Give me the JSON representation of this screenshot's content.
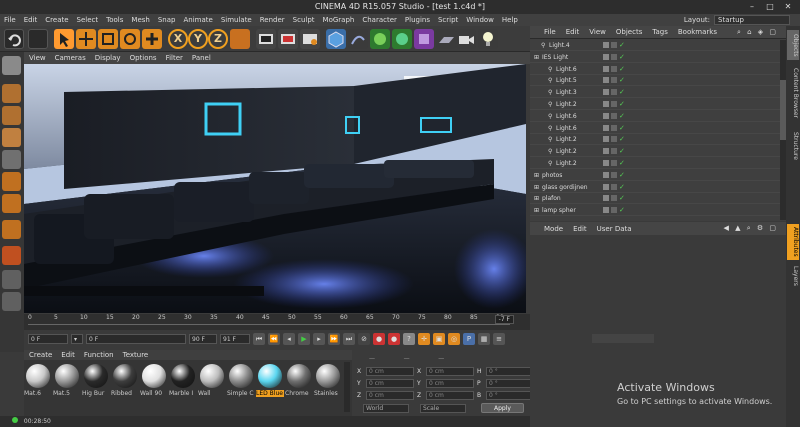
{
  "window": {
    "title": "CINEMA 4D R15.057 Studio - [test 1.c4d *]"
  },
  "menu": [
    "File",
    "Edit",
    "Create",
    "Select",
    "Tools",
    "Mesh",
    "Snap",
    "Animate",
    "Simulate",
    "Render",
    "Sculpt",
    "MoGraph",
    "Character",
    "Plugins",
    "Script",
    "Window",
    "Help"
  ],
  "layout": {
    "label": "Layout:",
    "value": "Startup"
  },
  "toolbar": {
    "axis_x": "X",
    "axis_y": "Y",
    "axis_z": "Z"
  },
  "viewport_menu": [
    "View",
    "Cameras",
    "Display",
    "Options",
    "Filter",
    "Panel"
  ],
  "timeline": {
    "ticks": [
      "0",
      "5",
      "10",
      "15",
      "20",
      "25",
      "30",
      "35",
      "40",
      "45",
      "50",
      "55",
      "60",
      "65",
      "70",
      "75",
      "80",
      "85",
      "90"
    ],
    "current_frame": "-7 F"
  },
  "transport": {
    "start": "0 F",
    "current": "0 F",
    "end": "90 F",
    "preview_end": "91 F"
  },
  "material_menu": [
    "Create",
    "Edit",
    "Function",
    "Texture"
  ],
  "materials": [
    {
      "name": "Mat.6",
      "color": "#c8c8c8"
    },
    {
      "name": "Mat.5",
      "color": "#9a9a9a"
    },
    {
      "name": "Hig Bur",
      "color": "#2a2a2a"
    },
    {
      "name": "Ribbed",
      "color": "#3d3d3d"
    },
    {
      "name": "Wall 90",
      "color": "#e0e0e0"
    },
    {
      "name": "Marble I",
      "color": "#222222"
    },
    {
      "name": "Wall",
      "color": "#bdbdbd"
    },
    {
      "name": "Simple C",
      "color": "#8c8c8c"
    },
    {
      "name": "LED Blue",
      "color": "#5ad6f0",
      "selected": true
    },
    {
      "name": "Chrome",
      "color": "#6f6f6f"
    },
    {
      "name": "Stainles",
      "color": "#9b9b9b"
    }
  ],
  "coords": {
    "rows": [
      {
        "a": "X",
        "v1": "0 cm",
        "b": "X",
        "v2": "0 cm",
        "c": "H",
        "v3": "0 °"
      },
      {
        "a": "Y",
        "v1": "0 cm",
        "b": "Y",
        "v2": "0 cm",
        "c": "P",
        "v3": "0 °"
      },
      {
        "a": "Z",
        "v1": "0 cm",
        "b": "Z",
        "v2": "0 cm",
        "c": "B",
        "v3": "0 °"
      }
    ],
    "mode": "World",
    "scale": "Scale",
    "apply": "Apply"
  },
  "status": {
    "time": "00:28:50"
  },
  "object_manager": {
    "menu": [
      "File",
      "Edit",
      "View",
      "Objects",
      "Tags",
      "Bookmarks"
    ],
    "rows": [
      {
        "name": "Light.4",
        "indent": 1
      },
      {
        "name": "IES Light",
        "indent": 0
      },
      {
        "name": "Light.6",
        "indent": 2
      },
      {
        "name": "Light.5",
        "indent": 2
      },
      {
        "name": "Light.3",
        "indent": 2
      },
      {
        "name": "Light.2",
        "indent": 2
      },
      {
        "name": "Light.6",
        "indent": 2
      },
      {
        "name": "Light.6",
        "indent": 2
      },
      {
        "name": "Light.2",
        "indent": 2
      },
      {
        "name": "Light.2",
        "indent": 2
      },
      {
        "name": "Light.2",
        "indent": 2
      },
      {
        "name": "photos",
        "indent": 0
      },
      {
        "name": "glass gordijnen",
        "indent": 0
      },
      {
        "name": "plafon",
        "indent": 0
      },
      {
        "name": "lamp spher",
        "indent": 0
      }
    ]
  },
  "attributes": {
    "menu": [
      "Mode",
      "Edit",
      "User Data"
    ]
  },
  "side_tabs": [
    "Objects",
    "Content Browser",
    "Structure",
    "Attributes",
    "Layers"
  ],
  "watermark": {
    "line1": "Activate Windows",
    "line2": "Go to PC settings to activate Windows."
  },
  "colors": {
    "accent": "#f0a020",
    "led": "#3fd0f5"
  }
}
